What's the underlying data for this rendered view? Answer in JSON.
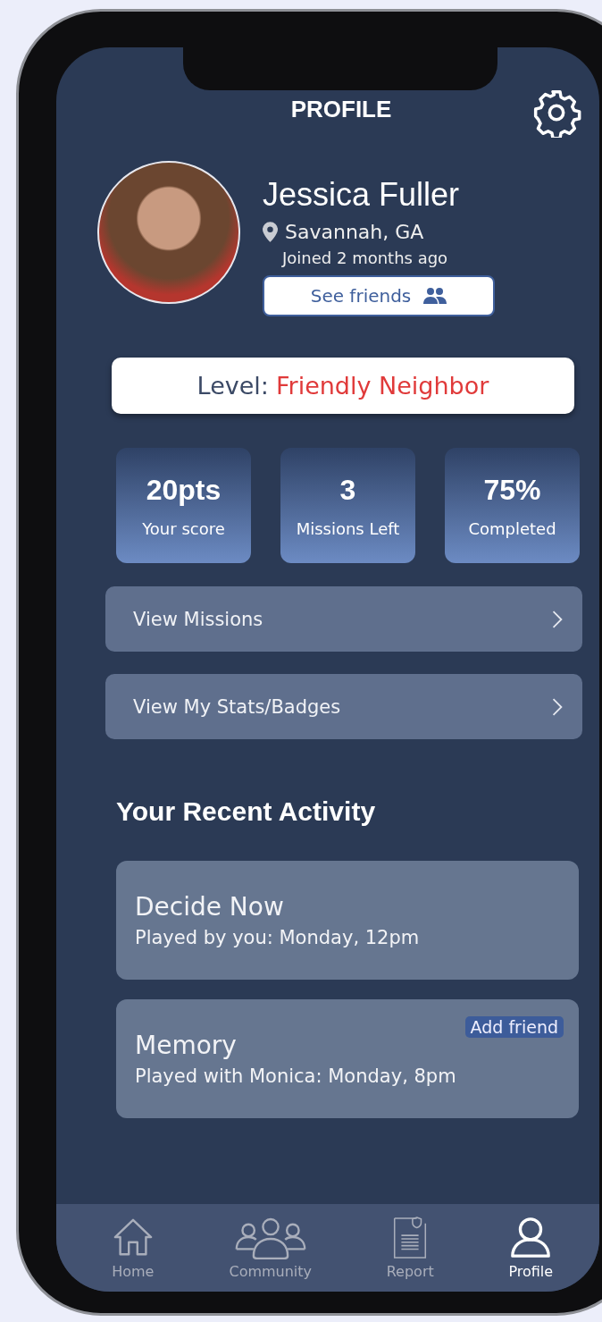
{
  "header": {
    "title": "PROFILE"
  },
  "profile": {
    "name": "Jessica Fuller",
    "location": "Savannah, GA",
    "joined": "Joined 2 months ago",
    "friends_button": "See friends"
  },
  "level": {
    "label": "Level:",
    "value": "Friendly Neighbor"
  },
  "stats": [
    {
      "value": "20pts",
      "label": "Your score"
    },
    {
      "value": "3",
      "label": "Missions Left"
    },
    {
      "value": "75%",
      "label": "Completed"
    }
  ],
  "links": [
    {
      "label": "View Missions"
    },
    {
      "label": "View My Stats/Badges"
    }
  ],
  "recent_activity": {
    "title": "Your Recent Activity",
    "items": [
      {
        "title": "Decide Now",
        "detail": "Played by you: Monday, 12pm"
      },
      {
        "title": "Memory",
        "detail": "Played with Monica: Monday, 8pm",
        "action": "Add friend"
      }
    ]
  },
  "nav": [
    {
      "kind": "home",
      "label": "Home",
      "selected": false
    },
    {
      "kind": "community",
      "label": "Community",
      "selected": false
    },
    {
      "kind": "report",
      "label": "Report",
      "selected": false
    },
    {
      "kind": "profile",
      "label": "Profile",
      "selected": true
    }
  ]
}
